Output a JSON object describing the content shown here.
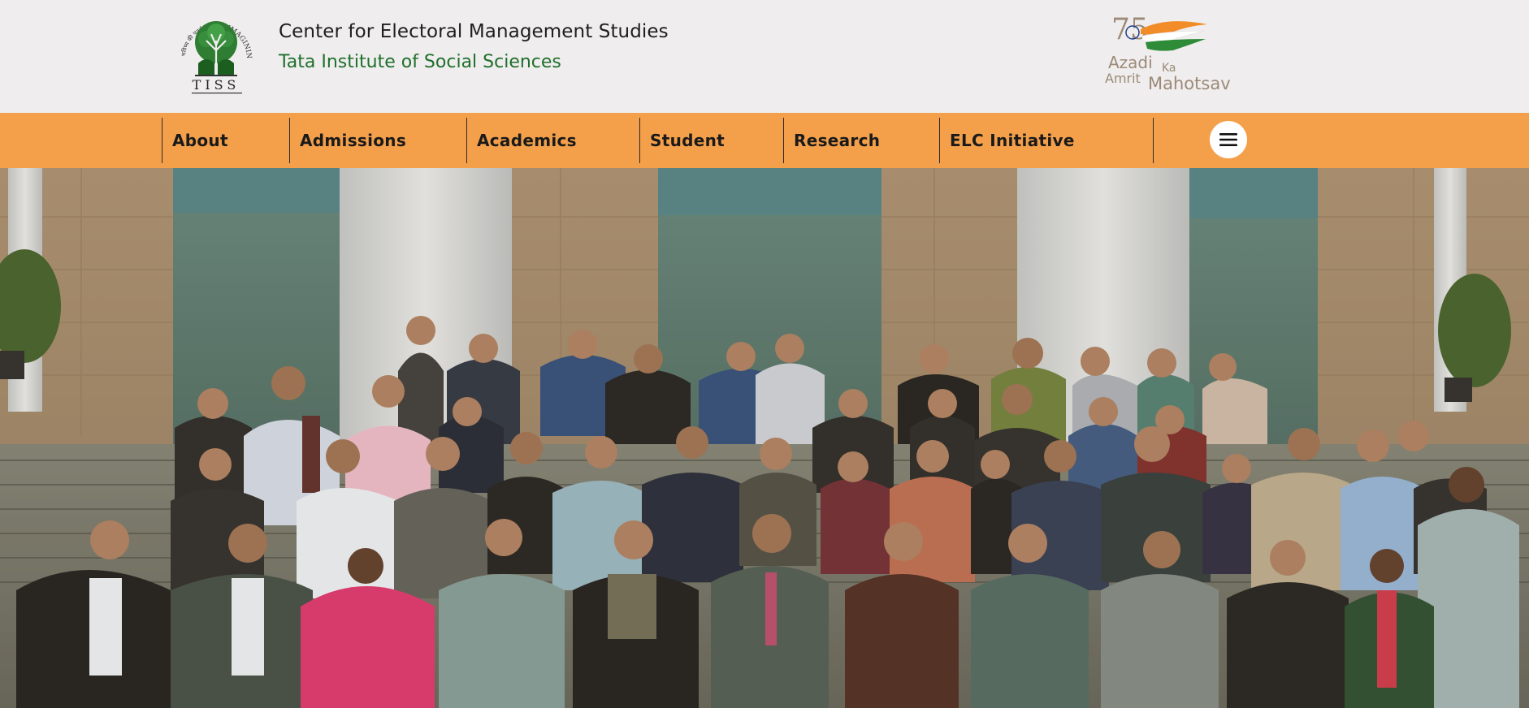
{
  "header": {
    "title": "Center for Electoral Management Studies",
    "subtitle": "Tata Institute of Social Sciences",
    "logo": {
      "name": "tiss-logo",
      "text": "TISS",
      "arc_text": "RE-IMAGINING FUTURES"
    },
    "badge": {
      "name": "azadi-ka-amrit-mahotsav-logo",
      "number": "75",
      "line1": "Azadi",
      "line1b": "Ka",
      "line2a": "Amrit",
      "line2b": "Mahotsav"
    }
  },
  "nav": {
    "items": [
      {
        "label": "About"
      },
      {
        "label": "Admissions"
      },
      {
        "label": "Academics"
      },
      {
        "label": "Student"
      },
      {
        "label": "Research"
      },
      {
        "label": "ELC Initiative"
      }
    ],
    "menu_icon": "hamburger-menu-icon"
  },
  "hero": {
    "image": "group-photo"
  },
  "colors": {
    "nav_bg": "#f4a04a",
    "header_bg": "#efeded",
    "brand_green": "#1f6f2c"
  }
}
